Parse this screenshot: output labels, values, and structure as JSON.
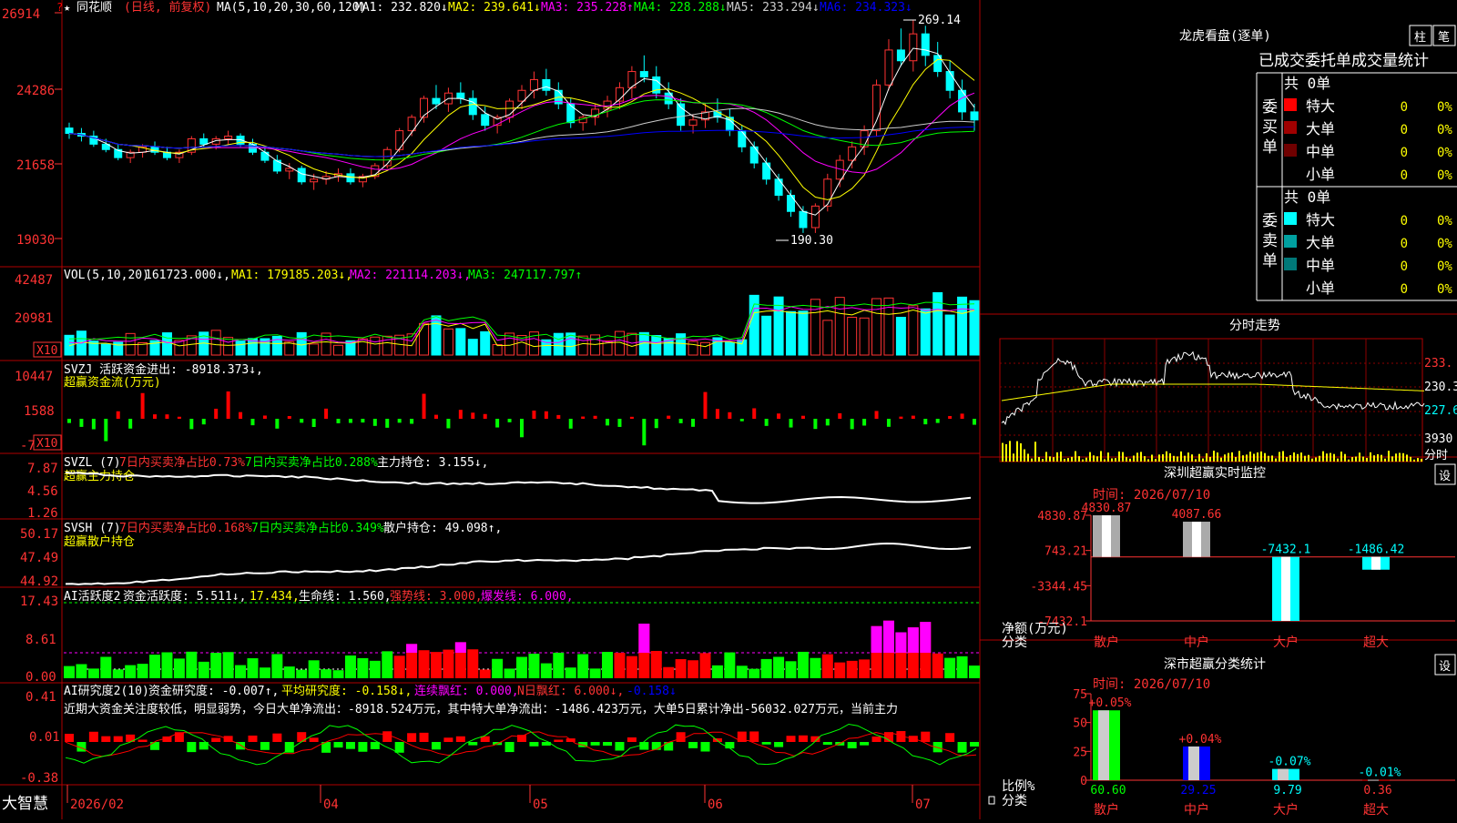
{
  "stock": {
    "star": "★",
    "name": "同花顺",
    "mode": "(日线, 前复权)",
    "top_marker": "?"
  },
  "ma_line": [
    {
      "text": "MA(5,10,20,30,60,120)",
      "color": "#ffffff"
    },
    {
      "text": "MA1: 232.820↓",
      "color": "#ffffff"
    },
    {
      "text": "MA2: 239.641↓",
      "color": "#ffff00"
    },
    {
      "text": "MA3: 235.228↑",
      "color": "#ff00ff"
    },
    {
      "text": "MA4: 228.288↓",
      "color": "#00ff00"
    },
    {
      "text": "MA5: 233.294↓",
      "color": "#cccccc"
    },
    {
      "text": "MA6: 234.323↓",
      "color": "#0000ff"
    }
  ],
  "price_axis": [
    "26914",
    "24286",
    "21658",
    "19030"
  ],
  "price_marks": {
    "high": "269.14",
    "low": "190.30"
  },
  "vol_line": [
    {
      "text": "VOL(5,10,20)",
      "color": "#ffffff"
    },
    {
      "text": "161723.000↓,",
      "color": "#ffffff"
    },
    {
      "text": "MA1: 179185.203↓,",
      "color": "#ffff00"
    },
    {
      "text": "MA2: 221114.203↓,",
      "color": "#ff00ff"
    },
    {
      "text": "MA3: 247117.797↑",
      "color": "#00ff00"
    }
  ],
  "vol_axis": [
    "42487",
    "20981"
  ],
  "vol_scale": "X10",
  "svzj_line": [
    {
      "text": "SVZJ  活跃资金进出: -8918.373↓,",
      "color": "#ffffff"
    }
  ],
  "svzj_sub": "超赢资金流(万元)",
  "svzj_axis": [
    "10447",
    "1588",
    "-7"
  ],
  "svzl_line": [
    {
      "text": "SVZL (7)",
      "color": "#ffffff"
    },
    {
      "text": "7日内买卖净占比0.73%",
      "color": "#ff3333"
    },
    {
      "text": "7日内买卖净占比0.288%",
      "color": "#00ff00"
    },
    {
      "text": "主力持仓: 3.155↓,",
      "color": "#ffffff"
    }
  ],
  "svzl_sub": "超赢主力持仓",
  "svzl_axis": [
    "7.87",
    "4.56",
    "1.26"
  ],
  "svsh_line": [
    {
      "text": "SVSH (7)",
      "color": "#ffffff"
    },
    {
      "text": "7日内买卖净占比0.168%",
      "color": "#ff3333"
    },
    {
      "text": "7日内买卖净占比0.349%",
      "color": "#00ff00"
    },
    {
      "text": "散户持仓: 49.098↑,",
      "color": "#ffffff"
    }
  ],
  "svsh_sub": "超赢散户持仓",
  "svsh_axis": [
    "50.17",
    "47.49",
    "44.92"
  ],
  "ai_line": [
    {
      "text": "AI活跃度2",
      "color": "#ffffff"
    },
    {
      "text": "资金活跃度: 5.511↓,",
      "color": "#ffffff"
    },
    {
      "text": "17.434,",
      "color": "#ffff00"
    },
    {
      "text": "生命线: 1.560,",
      "color": "#ffffff"
    },
    {
      "text": "强势线: 3.000,",
      "color": "#ff3333"
    },
    {
      "text": "爆发线: 6.000,",
      "color": "#ff00ff"
    }
  ],
  "ai_axis": [
    "17.43",
    "8.61",
    "0.00"
  ],
  "rs_line": [
    {
      "text": "AI研究度2(10)",
      "color": "#ffffff"
    },
    {
      "text": "资金研究度: -0.007↑,",
      "color": "#ffffff"
    },
    {
      "text": "平均研究度: -0.158↓,",
      "color": "#ffff00"
    },
    {
      "text": "连续飘红: 0.000,",
      "color": "#ff00ff"
    },
    {
      "text": "N日飘红: 6.000↓,",
      "color": "#ff3333"
    },
    {
      "text": "-0.158↓",
      "color": "#0000ff"
    }
  ],
  "rs_comment": "近期大资金关注度较低，明显弱势，今日大单净流出：-8918.524万元，其中特大单净流出：-1486.423万元，大单5日累计净出-56032.027万元，当前主力",
  "rs_axis": [
    "0.41",
    "0.01",
    "-0.38"
  ],
  "bottom": {
    "logo": "大智慧",
    "dates": [
      "2026/02",
      "04",
      "05",
      "06",
      "07"
    ]
  },
  "lhb": {
    "title": "龙虎看盘(逐单)",
    "btn1": "柱",
    "btn2": "笔",
    "subtitle": "已成交委托单成交量统计",
    "buy": {
      "side": "委买单",
      "total": "共 0单",
      "rows": [
        {
          "label": "特大",
          "value": "0",
          "pct": "0%",
          "color": "#ff0000"
        },
        {
          "label": "大单",
          "value": "0",
          "pct": "0%",
          "color": "#a00000"
        },
        {
          "label": "中单",
          "value": "0",
          "pct": "0%",
          "color": "#700000"
        },
        {
          "label": "小单",
          "value": "0",
          "pct": "0%",
          "color": ""
        }
      ]
    },
    "sell": {
      "side": "委卖单",
      "total": "共 0单",
      "rows": [
        {
          "label": "特大",
          "value": "0",
          "pct": "0%",
          "color": "#00ffff"
        },
        {
          "label": "大单",
          "value": "0",
          "pct": "0%",
          "color": "#00a0a0"
        },
        {
          "label": "中单",
          "value": "0",
          "pct": "0%",
          "color": "#007878"
        },
        {
          "label": "小单",
          "value": "0",
          "pct": "0%",
          "color": ""
        }
      ]
    }
  },
  "intraday": {
    "title": "分时走势",
    "axis": [
      "233.",
      "230.3",
      "227.6"
    ],
    "vol": "3930",
    "unit": "分时"
  },
  "monitor": {
    "title": "深圳超赢实时监控",
    "btn": "设",
    "time": "时间: 2026/07/10",
    "axis": [
      "4830.87",
      "743.21",
      "-3344.45",
      "-7432.1"
    ],
    "ylabel": "净额(万元)",
    "xlabel": "分类",
    "cats": [
      "散户",
      "中户",
      "大户",
      "超大"
    ],
    "values": [
      4830.87,
      4087.66,
      -7432.1,
      -1486.42
    ],
    "labels": [
      "4830.87",
      "4087.66",
      "-7432.1",
      "-1486.42"
    ],
    "range": [
      -7432.1,
      4830.87
    ]
  },
  "classify": {
    "title": "深市超赢分类统计",
    "btn": "设",
    "time": "时间: 2026/07/10",
    "axis": [
      "75",
      "50",
      "25",
      "0"
    ],
    "ylabel": "比例%",
    "xlabel": "分类",
    "cats": [
      "散户",
      "中户",
      "大户",
      "超大"
    ],
    "values": [
      60.6,
      29.25,
      9.79,
      0.36
    ],
    "labels": [
      "60.60",
      "29.25",
      "9.79",
      "0.36"
    ],
    "changes": [
      "+0.05%",
      "+0.04%",
      "-0.07%",
      "-0.01%"
    ],
    "bar_colors": [
      "#00ff00",
      "#0000ff",
      "#00ffff",
      "#ff0000"
    ],
    "range": [
      0,
      75
    ]
  }
}
